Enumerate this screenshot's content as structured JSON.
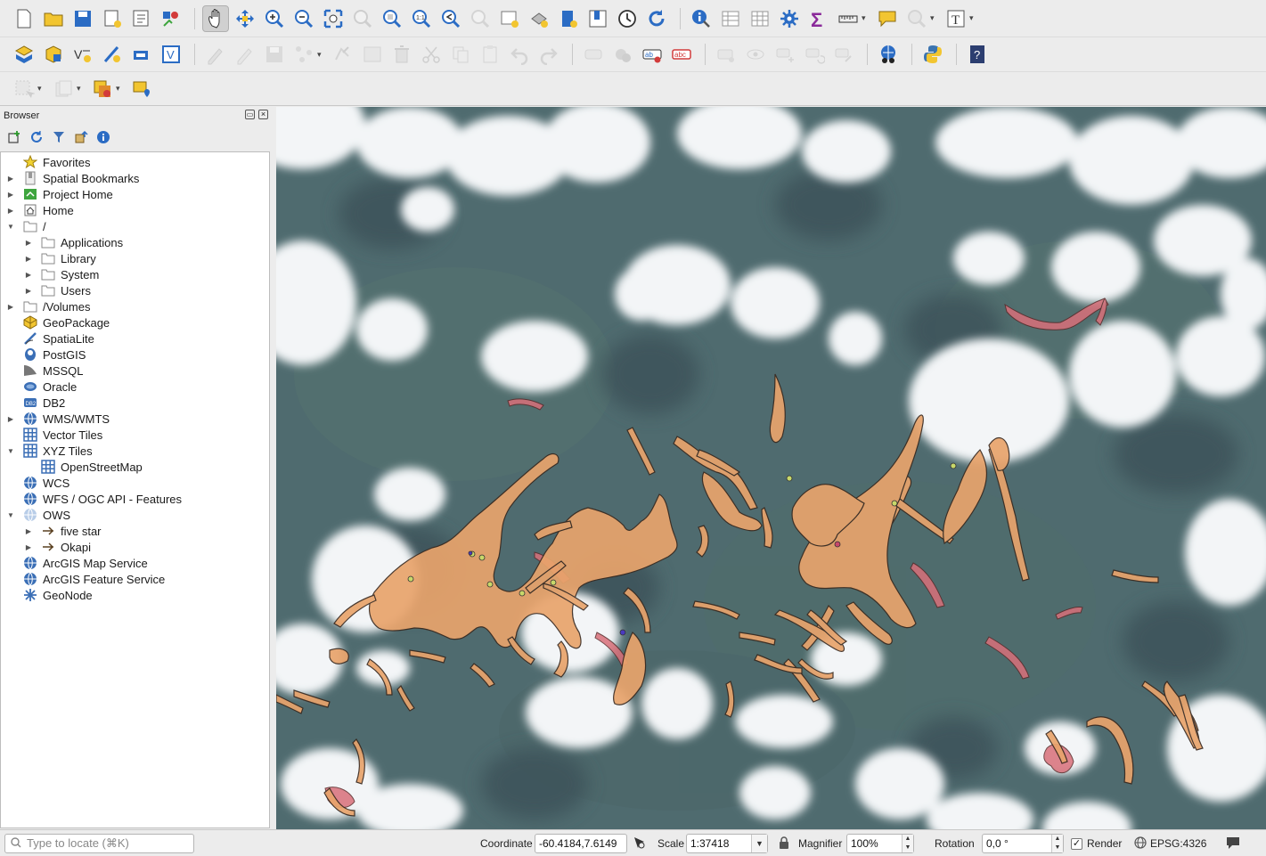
{
  "toolbar1": {
    "icons": [
      "new-project-icon",
      "open-project-icon",
      "save-project-icon",
      "new-print-layout-icon",
      "layout-manager-icon",
      "style-manager-icon",
      "pan-icon",
      "pan-to-selection-icon",
      "zoom-in-icon",
      "zoom-out-icon",
      "zoom-full-icon",
      "zoom-to-selection-icon",
      "zoom-to-layer-icon",
      "zoom-native-icon",
      "zoom-last-icon",
      "zoom-next-icon",
      "new-map-view-icon",
      "new-3d-view-icon",
      "new-bookmark-icon",
      "show-bookmarks-icon",
      "temporal-controller-icon",
      "refresh-icon",
      "identify-icon",
      "attribute-table-icon",
      "field-calculator-icon",
      "processing-toolbox-icon",
      "statistics-sigma-icon",
      "measure-icon",
      "map-tips-icon",
      "select-by-location-icon",
      "text-annotation-icon"
    ]
  },
  "toolbar2": {
    "icons": [
      "data-source-manager-icon",
      "new-geopackage-layer-icon",
      "new-shapefile-layer-icon",
      "new-spatialite-layer-icon",
      "new-temp-scratch-layer-icon",
      "new-virtual-layer-icon",
      "current-edits-icon",
      "toggle-editing-icon",
      "save-edits-icon",
      "digitize-icon",
      "vertex-tool-icon",
      "modify-attributes-icon",
      "delete-selected-icon",
      "cut-features-icon",
      "copy-features-icon",
      "paste-features-icon",
      "undo-icon",
      "redo-icon",
      "label-toolbar-icon",
      "diagram-options-icon",
      "layer-labeling-icon",
      "layer-labeling-red-icon",
      "pin-labels-icon",
      "show-hide-labels-icon",
      "move-label-icon",
      "rotate-label-icon",
      "change-label-icon",
      "georeferencer-icon",
      "python-console-icon",
      "help-icon"
    ]
  },
  "toolbar3": {
    "icons": [
      "select-features-icon",
      "deselect-icon",
      "select-by-expression-icon",
      "add-feature-icon"
    ]
  },
  "browser": {
    "title": "Browser",
    "items": [
      {
        "label": "Favorites",
        "icon": "star-icon",
        "depth": 0,
        "arrow": ""
      },
      {
        "label": "Spatial Bookmarks",
        "icon": "bookmark-icon",
        "depth": 0,
        "arrow": "▶"
      },
      {
        "label": "Project Home",
        "icon": "project-home-icon",
        "depth": 0,
        "arrow": "▶"
      },
      {
        "label": "Home",
        "icon": "home-icon",
        "depth": 0,
        "arrow": "▶"
      },
      {
        "label": "/",
        "icon": "folder-icon",
        "depth": 0,
        "arrow": "▼"
      },
      {
        "label": "Applications",
        "icon": "folder-icon",
        "depth": 1,
        "arrow": "▶"
      },
      {
        "label": "Library",
        "icon": "folder-icon",
        "depth": 1,
        "arrow": "▶"
      },
      {
        "label": "System",
        "icon": "folder-icon",
        "depth": 1,
        "arrow": "▶"
      },
      {
        "label": "Users",
        "icon": "folder-icon",
        "depth": 1,
        "arrow": "▶"
      },
      {
        "label": "/Volumes",
        "icon": "folder-icon",
        "depth": 0,
        "arrow": "▶"
      },
      {
        "label": "GeoPackage",
        "icon": "geopackage-icon",
        "depth": 0,
        "arrow": ""
      },
      {
        "label": "SpatiaLite",
        "icon": "spatialite-icon",
        "depth": 0,
        "arrow": ""
      },
      {
        "label": "PostGIS",
        "icon": "postgis-icon",
        "depth": 0,
        "arrow": ""
      },
      {
        "label": "MSSQL",
        "icon": "mssql-icon",
        "depth": 0,
        "arrow": ""
      },
      {
        "label": "Oracle",
        "icon": "oracle-icon",
        "depth": 0,
        "arrow": ""
      },
      {
        "label": "DB2",
        "icon": "db2-icon",
        "depth": 0,
        "arrow": ""
      },
      {
        "label": "WMS/WMTS",
        "icon": "globe-icon",
        "depth": 0,
        "arrow": "▶"
      },
      {
        "label": "Vector Tiles",
        "icon": "grid-icon",
        "depth": 0,
        "arrow": ""
      },
      {
        "label": "XYZ Tiles",
        "icon": "grid-icon",
        "depth": 0,
        "arrow": "▼"
      },
      {
        "label": "OpenStreetMap",
        "icon": "grid-icon",
        "depth": 1,
        "arrow": ""
      },
      {
        "label": "WCS",
        "icon": "globe-icon",
        "depth": 0,
        "arrow": ""
      },
      {
        "label": "WFS / OGC API - Features",
        "icon": "globe-icon",
        "depth": 0,
        "arrow": ""
      },
      {
        "label": "OWS",
        "icon": "globe-light-icon",
        "depth": 0,
        "arrow": "▼"
      },
      {
        "label": "five star",
        "icon": "connection-icon",
        "depth": 1,
        "arrow": "▶"
      },
      {
        "label": "Okapi",
        "icon": "connection-icon",
        "depth": 1,
        "arrow": "▶"
      },
      {
        "label": "ArcGIS Map Service",
        "icon": "globe-icon",
        "depth": 0,
        "arrow": ""
      },
      {
        "label": "ArcGIS Feature Service",
        "icon": "globe-icon",
        "depth": 0,
        "arrow": ""
      },
      {
        "label": "GeoNode",
        "icon": "geonode-icon",
        "depth": 0,
        "arrow": ""
      }
    ]
  },
  "status": {
    "locator_placeholder": "Type to locate (⌘K)",
    "coordinate_label": "Coordinate",
    "coordinate_value": "-60.4184,7.6149",
    "scale_label": "Scale",
    "scale_value": "1:37418",
    "magnifier_label": "Magnifier",
    "magnifier_value": "100%",
    "rotation_label": "Rotation",
    "rotation_value": "0,0 °",
    "render_label": "Render",
    "crs_label": "EPSG:4326"
  },
  "colors": {
    "forest": "#4e6a6e",
    "cloud": "#f4f6f8",
    "shadow": "#3f555c",
    "mining_polygon": "#e9a46c",
    "mining_outline": "#3a2a20",
    "red_polygon": "#d9707a"
  }
}
